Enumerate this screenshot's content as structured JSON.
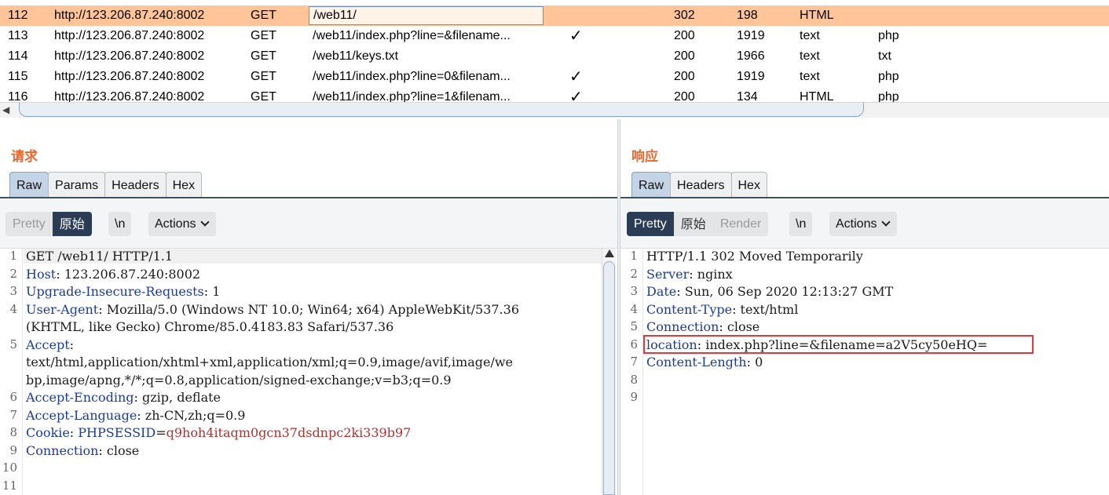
{
  "history": {
    "rows": [
      {
        "num": "112",
        "host": "http://123.206.87.240:8002",
        "method": "GET",
        "url": "/web11/",
        "params": "",
        "status": "302",
        "length": "198",
        "mime": "HTML",
        "ext": ""
      },
      {
        "num": "113",
        "host": "http://123.206.87.240:8002",
        "method": "GET",
        "url": "/web11/index.php?line=&filename...",
        "params": "✓",
        "status": "200",
        "length": "1919",
        "mime": "text",
        "ext": "php"
      },
      {
        "num": "114",
        "host": "http://123.206.87.240:8002",
        "method": "GET",
        "url": "/web11/keys.txt",
        "params": "",
        "status": "200",
        "length": "1966",
        "mime": "text",
        "ext": "txt"
      },
      {
        "num": "115",
        "host": "http://123.206.87.240:8002",
        "method": "GET",
        "url": "/web11/index.php?line=0&filenam...",
        "params": "✓",
        "status": "200",
        "length": "1919",
        "mime": "text",
        "ext": "php"
      },
      {
        "num": "116",
        "host": "http://123.206.87.240:8002",
        "method": "GET",
        "url": "/web11/index.php?line=1&filenam...",
        "params": "✓",
        "status": "200",
        "length": "134",
        "mime": "HTML",
        "ext": "php"
      }
    ],
    "selected_row": "112",
    "scroll_left_arrow": "◀"
  },
  "request": {
    "title": "请求",
    "tabs": [
      "Raw",
      "Params",
      "Headers",
      "Hex"
    ],
    "active_tab": "Raw",
    "view_modes": [
      "Pretty",
      "原始"
    ],
    "active_view_mode": "原始",
    "newline_toggle": "\\n",
    "actions_label": "Actions",
    "lines": {
      "l1": "GET /web11/ HTTP/1.1",
      "l2_key": "Host",
      "l2_val": " 123.206.87.240:8002",
      "l3_key": "Upgrade-Insecure-Requests",
      "l3_val": " 1",
      "l4_key": "User-Agent",
      "l4_val": " Mozilla/5.0 (Windows NT 10.0; Win64; x64) AppleWebKit/537.36",
      "l4_wrap": "(KHTML, like Gecko) Chrome/85.0.4183.83 Safari/537.36",
      "l5_key": "Accept",
      "l5_wrap1": "text/html,application/xhtml+xml,application/xml;q=0.9,image/avif,image/we",
      "l5_wrap2": "bp,image/apng,*/*;q=0.8,application/signed-exchange;v=b3;q=0.9",
      "l6_key": "Accept-Encoding",
      "l6_val": " gzip, deflate",
      "l7_key": "Accept-Language",
      "l7_val": " zh-CN,zh;q=0.9",
      "l8_key": "Cookie",
      "l8_ckey": " PHPSESSID",
      "l8_cval": "q9hoh4itaqm0gcn37dsdnpc2ki339b97",
      "l9_key": "Connection",
      "l9_val": " close"
    },
    "line_numbers": [
      "1",
      "2",
      "3",
      "4",
      "5",
      "6",
      "7",
      "8",
      "9",
      "10",
      "11"
    ]
  },
  "response": {
    "title": "响应",
    "tabs": [
      "Raw",
      "Headers",
      "Hex"
    ],
    "active_tab": "Raw",
    "view_modes": [
      "Pretty",
      "原始",
      "Render"
    ],
    "active_view_mode": "Pretty",
    "newline_toggle": "\\n",
    "actions_label": "Actions",
    "lines": {
      "l1": "HTTP/1.1 302 Moved Temporarily",
      "l2_key": "Server",
      "l2_val": " nginx",
      "l3_key": "Date",
      "l3_val": " Sun, 06 Sep 2020 12:13:27 GMT",
      "l4_key": "Content-Type",
      "l4_val": " text/html",
      "l5_key": "Connection",
      "l5_val": " close",
      "l6_key": "location",
      "l6_val": " index.php?line=&filename=a2V5cy50eHQ=",
      "l7_key": "Content-Length",
      "l7_val": " 0"
    },
    "line_numbers": [
      "1",
      "2",
      "3",
      "4",
      "5",
      "6",
      "7",
      "8",
      "9"
    ]
  },
  "colors": {
    "selected_row": "#ffc599",
    "header_key": "#1c3a9e",
    "cookie_value": "#b03030",
    "pane_title": "#e8672c",
    "active_view_mode": "#2b3d55",
    "highlight_box": "#e23a3a"
  }
}
